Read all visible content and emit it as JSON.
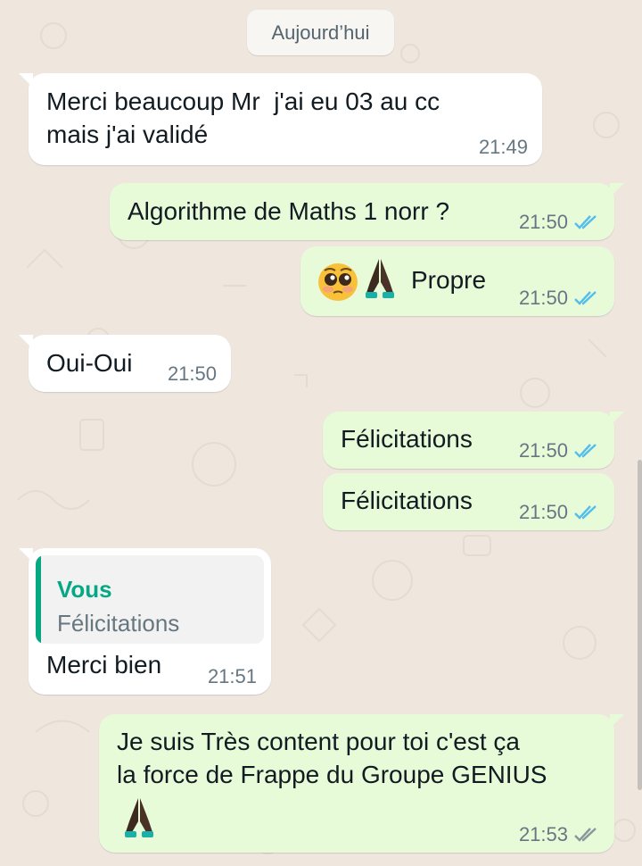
{
  "chat": {
    "date_separator": "Aujourd’hui",
    "messages": [
      {
        "direction": "in",
        "lines": [
          "Merci beaucoup Mr  j'ai eu 03 au cc",
          "mais j'ai validé"
        ],
        "time": "21:49"
      },
      {
        "direction": "out",
        "lines": [
          "Algorithme de Maths 1 norr ?"
        ],
        "time": "21:50",
        "status": "read"
      },
      {
        "direction": "out",
        "lines": [
          "Propre"
        ],
        "time": "21:50",
        "status": "read",
        "emojis": [
          "pleading-face",
          "folded-hands"
        ]
      },
      {
        "direction": "in",
        "lines": [
          "Oui-Oui"
        ],
        "time": "21:50"
      },
      {
        "direction": "out",
        "lines": [
          "Félicitations"
        ],
        "time": "21:50",
        "status": "read"
      },
      {
        "direction": "out",
        "lines": [
          "Félicitations"
        ],
        "time": "21:50",
        "status": "read"
      },
      {
        "direction": "in",
        "reply_to": {
          "author": "Vous",
          "text": "Félicitations"
        },
        "lines": [
          "Merci bien"
        ],
        "time": "21:51"
      },
      {
        "direction": "out",
        "lines": [
          "Je suis Très content pour toi c'est ça",
          "la force de Frappe du Groupe GENIUS"
        ],
        "time": "21:53",
        "status": "delivered",
        "emojis": [
          "folded-hands"
        ]
      }
    ]
  },
  "colors": {
    "background": "#efe7de",
    "incoming_bubble": "#ffffff",
    "outgoing_bubble": "#e8fbd9",
    "read_ticks": "#53bdeb",
    "delivered_ticks": "#8a959b",
    "reply_accent": "#06a884"
  }
}
